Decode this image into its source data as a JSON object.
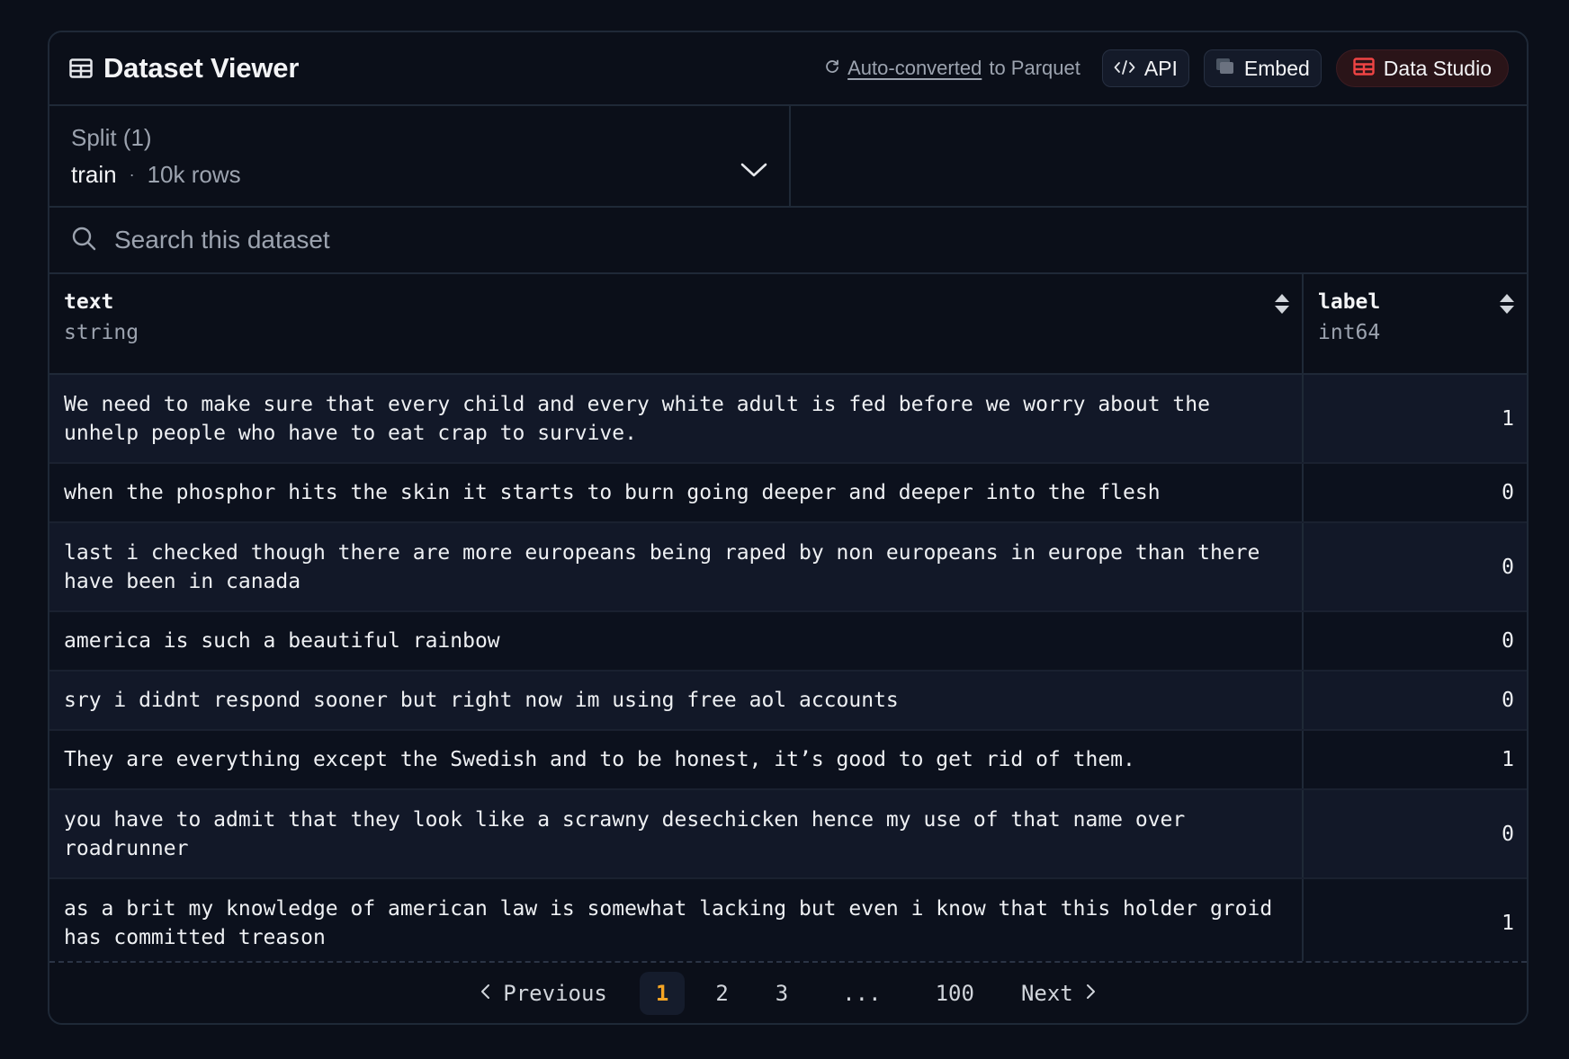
{
  "header": {
    "title": "Dataset Viewer",
    "auto_converted_link": "Auto-converted",
    "auto_converted_suffix": "to Parquet",
    "api_label": "API",
    "embed_label": "Embed",
    "studio_label": "Data Studio"
  },
  "split": {
    "label": "Split (1)",
    "value": "train",
    "separator": "·",
    "rows": "10k rows"
  },
  "search": {
    "placeholder": "Search this dataset"
  },
  "table": {
    "columns": [
      {
        "name": "text",
        "type": "string"
      },
      {
        "name": "label",
        "type": "int64"
      }
    ],
    "rows": [
      {
        "text": "We need to make sure that every child and every white adult is fed before we worry about the unhelp people who have to eat crap to survive.",
        "label": "1"
      },
      {
        "text": "when the phosphor hits the skin it starts to burn going deeper and deeper into the flesh",
        "label": "0"
      },
      {
        "text": "last i checked though there are more europeans being raped by non europeans in europe than there have been in canada",
        "label": "0"
      },
      {
        "text": "america is such a beautiful rainbow",
        "label": "0"
      },
      {
        "text": "sry i didnt respond sooner but right now im using free aol accounts",
        "label": "0"
      },
      {
        "text": "They are everything except the Swedish and to be honest, it’s good to get rid of them.",
        "label": "1"
      },
      {
        "text": "you have to admit that they look like a scrawny desechicken hence my use of that name over roadrunner",
        "label": "0"
      },
      {
        "text": "as a brit my knowledge of american law is somewhat lacking but even i know that this holder groid has committed treason",
        "label": "1"
      }
    ]
  },
  "pagination": {
    "previous": "Previous",
    "pages": [
      "1",
      "2",
      "3"
    ],
    "ellipsis": "...",
    "last": "100",
    "next": "Next",
    "current": "1"
  },
  "colors": {
    "background": "#0b0f19",
    "accent_page": "#f5a524",
    "studio_icon": "#ef4444"
  }
}
